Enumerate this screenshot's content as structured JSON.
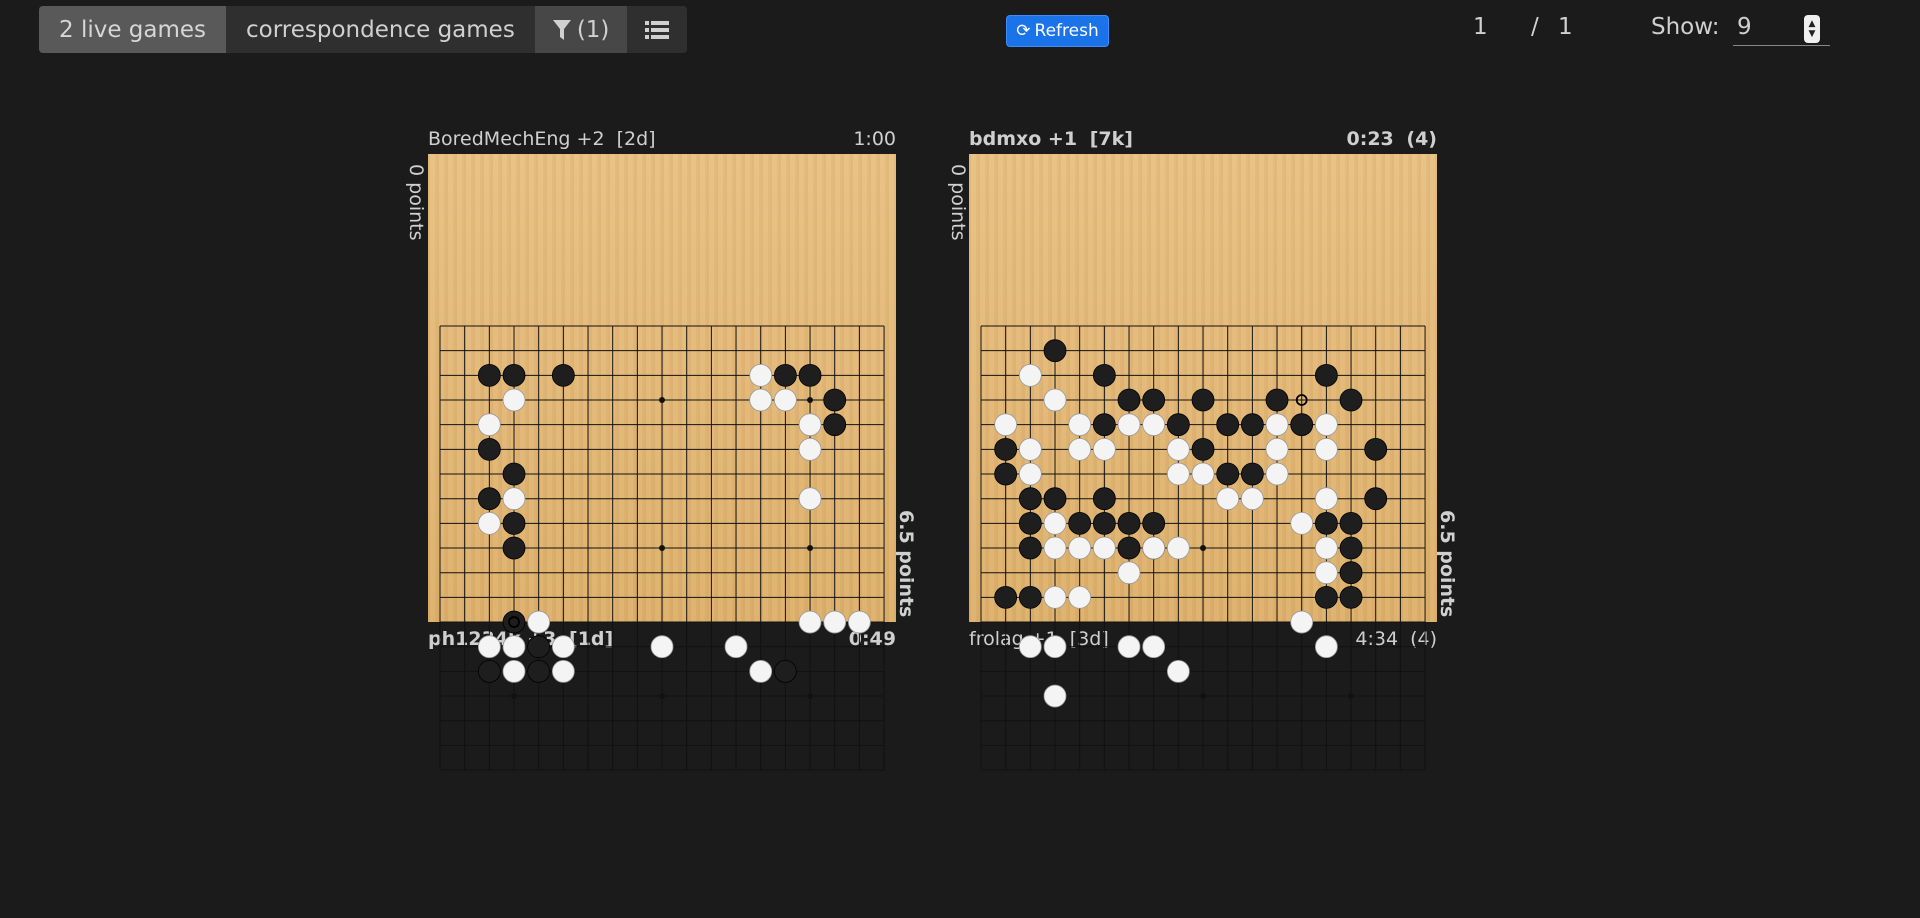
{
  "toolbar": {
    "tab_live": "2 live games",
    "tab_correspondence": "correspondence games",
    "filter_label": "(1)",
    "filter_icon": "filter-icon",
    "list_icon": "list-icon"
  },
  "refresh": {
    "label": "Refresh",
    "icon": "refresh-icon",
    "color": "#1a73e8"
  },
  "pager": {
    "current": "1",
    "separator": "/",
    "total": "1"
  },
  "show": {
    "label": "Show:",
    "value": "9"
  },
  "games": [
    {
      "top_player": "BoredMechEng +2",
      "top_rank": "[2d]",
      "top_time": "1:00",
      "top_points": "0 points",
      "bottom_player": "ph1234k +3",
      "bottom_rank": "[1d]",
      "bottom_time": "0:49",
      "bottom_points": "6.5 points"
    },
    {
      "top_player": "bdmxo +1",
      "top_rank": "[7k]",
      "top_time": "0:23",
      "top_periods": "(4)",
      "top_points": "0 points",
      "bottom_player": "frolag +1",
      "bottom_rank": "[3d]",
      "bottom_time": "4:34",
      "bottom_periods": "(4)",
      "bottom_points": "6.5 points"
    }
  ]
}
